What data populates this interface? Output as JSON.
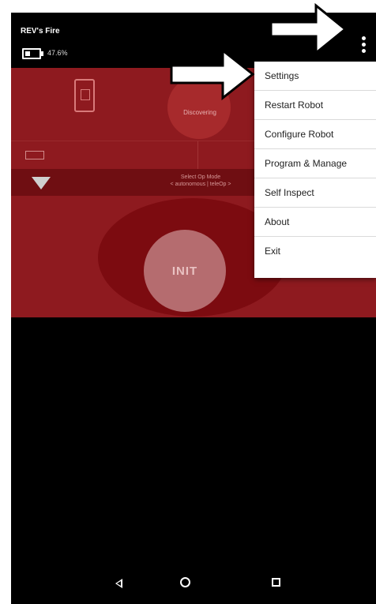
{
  "status_bar": {
    "device_name": "REV's Fire",
    "battery_percent_text": "47.6%"
  },
  "panel": {
    "discovery_text": "Discovering",
    "select_text_line1": "Select Op Mode",
    "select_text_line2": "< autonomous | teleOp >",
    "init_label": "INIT"
  },
  "menu": {
    "items": [
      "Settings",
      "Restart Robot",
      "Configure Robot",
      "Program & Manage",
      "Self Inspect",
      "About",
      "Exit"
    ]
  },
  "icons": {
    "overflow": "more-vert-icon",
    "back": "back-triangle-icon",
    "home": "home-circle-icon",
    "recent": "recent-square-icon"
  },
  "colors": {
    "panel_red": "#8e1a1f",
    "init_pink": "#b56c6f"
  }
}
